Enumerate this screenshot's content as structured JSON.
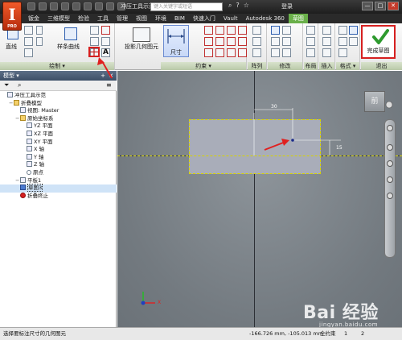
{
  "app": {
    "logo_letter": "I",
    "logo_sub": "PRO"
  },
  "titlebar": {
    "title": "冲压工具示范",
    "search_placeholder": "键入关键字或短语",
    "login": "登录",
    "window_buttons": [
      "—",
      "□",
      "✕"
    ]
  },
  "tabs": [
    "钣金",
    "三维模型",
    "检验",
    "工具",
    "管理",
    "视图",
    "环境",
    "BIM",
    "快速入门",
    "Vault",
    "Autodesk 360",
    "草图"
  ],
  "active_tab": "草图",
  "ribbon": {
    "groups": [
      {
        "label": "绘制 ▾"
      },
      {
        "label": "约束 ▾"
      },
      {
        "label": "阵列"
      },
      {
        "label": "修改"
      },
      {
        "label": "布局"
      },
      {
        "label": "插入"
      },
      {
        "label": "格式 ▾"
      },
      {
        "label": "退出"
      }
    ],
    "buttons": {
      "line": "直线",
      "spline": "样条曲线",
      "project": "投影几何图元",
      "dimension": "尺寸",
      "finish": "完成草图",
      "text": "A"
    }
  },
  "browser": {
    "header": "模型 ▾",
    "items": [
      {
        "label": "冲压工具示范",
        "icon": "part-icon"
      },
      {
        "label": "折叠模型",
        "icon": "folder-icon"
      },
      {
        "label": "视图: Master",
        "icon": "view-icon"
      },
      {
        "label": "原始坐标系",
        "icon": "folder-icon"
      },
      {
        "label": "YZ 平面",
        "icon": "plane-icon"
      },
      {
        "label": "XZ 平面",
        "icon": "plane-icon"
      },
      {
        "label": "XY 平面",
        "icon": "plane-icon"
      },
      {
        "label": "X 轴",
        "icon": "axis-icon"
      },
      {
        "label": "Y 轴",
        "icon": "axis-icon"
      },
      {
        "label": "Z 轴",
        "icon": "axis-icon"
      },
      {
        "label": "原点",
        "icon": "point-icon"
      },
      {
        "label": "平板1",
        "icon": "feature-icon"
      },
      {
        "label": "草图3",
        "icon": "sketch-icon"
      },
      {
        "label": "折叠终止",
        "icon": "end-of-fold-icon"
      }
    ]
  },
  "viewport": {
    "cube_label": "前",
    "dim_horizontal": "30",
    "dim_vertical": "15",
    "axis_label": "X"
  },
  "status": {
    "prompt": "选择要标注尺寸的几何图元",
    "coords": "-166.726 mm, -105.013 mm",
    "constraint": "全约束",
    "num1": "1",
    "num2": "2"
  },
  "watermark": {
    "text": "Bai 经验",
    "sub": "jingyan.baidu.com"
  },
  "colors": {
    "accent_tab": "#6ab04a",
    "highlight_red": "#d62020",
    "sketch_plane": "#a9adb9",
    "viewport_bg": "#7e858b"
  }
}
